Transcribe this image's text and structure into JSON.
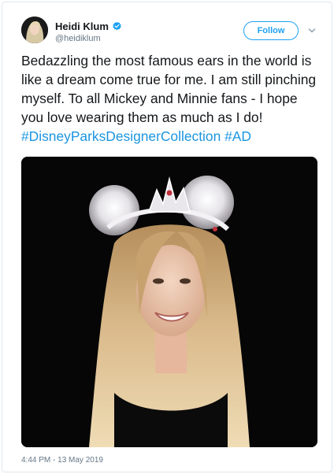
{
  "author": {
    "name": "Heidi Klum",
    "handle": "@heidiklum",
    "verified": true,
    "avatar_icon": "profile-photo"
  },
  "header": {
    "follow_label": "Follow",
    "more_icon": "chevron-down-icon"
  },
  "tweet": {
    "text": "Bedazzling the most famous ears in the world is like a dream come true for me. I am still pinching myself. To all Mickey and Minnie fans - I hope you love wearing them as much as I do!",
    "hashtags": [
      "#DisneyParksDesignerCollection",
      "#AD"
    ],
    "timestamp": "4:44 PM - 13 May 2019"
  },
  "colors": {
    "accent": "#1da1f2",
    "hashtag": "#1b95e0",
    "text": "#14171a",
    "muted": "#657786",
    "border": "#e1e8ed"
  }
}
